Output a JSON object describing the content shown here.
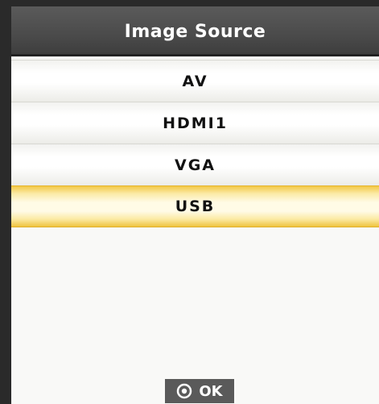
{
  "dialog": {
    "title": "Image Source"
  },
  "menu": {
    "items": [
      {
        "label": "AV",
        "selected": false
      },
      {
        "label": "HDMI1",
        "selected": false
      },
      {
        "label": "VGA",
        "selected": false
      },
      {
        "label": "USB",
        "selected": true
      }
    ]
  },
  "footer": {
    "ok_label": "OK",
    "ok_icon": "ok-button-icon"
  },
  "colors": {
    "title_bar": "#4a4a4a",
    "selected_highlight": "#f3c846",
    "panel_background": "#f7f7f5"
  }
}
